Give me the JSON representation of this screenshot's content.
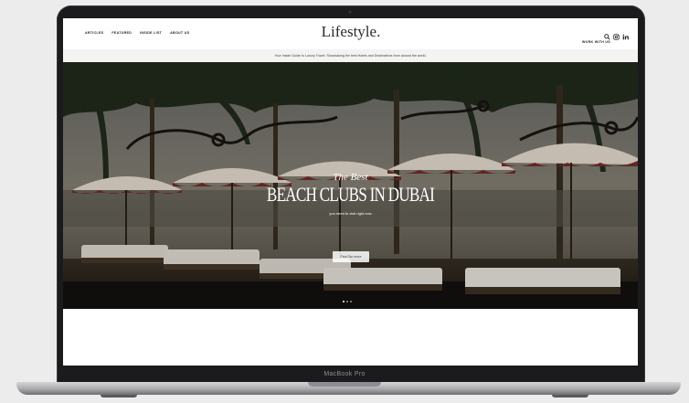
{
  "nav": {
    "left": [
      "ARTICLES",
      "FEATURED",
      "INSIDE LIST",
      "ABOUT US"
    ],
    "logo": "Lifestyle.",
    "right": "WORK WITH US",
    "icons": [
      "search-icon",
      "instagram-icon",
      "linkedin-icon"
    ]
  },
  "announcement": "Your Inside Guide to Luxury Travel. Showcasing the best Hotels and Destinations from around the world.",
  "hero": {
    "kicker": "The Best",
    "title": "BEACH CLUBS IN DUBAI",
    "subtitle": "you need to visit right now",
    "button": "Find Out more",
    "slides": 3,
    "active_slide": 1
  },
  "device_label": "MacBook Pro",
  "colors": {
    "awning_red": "#7b2e2a",
    "awning_cream": "#efe6d8",
    "palm_dark": "#1f2a1a"
  }
}
